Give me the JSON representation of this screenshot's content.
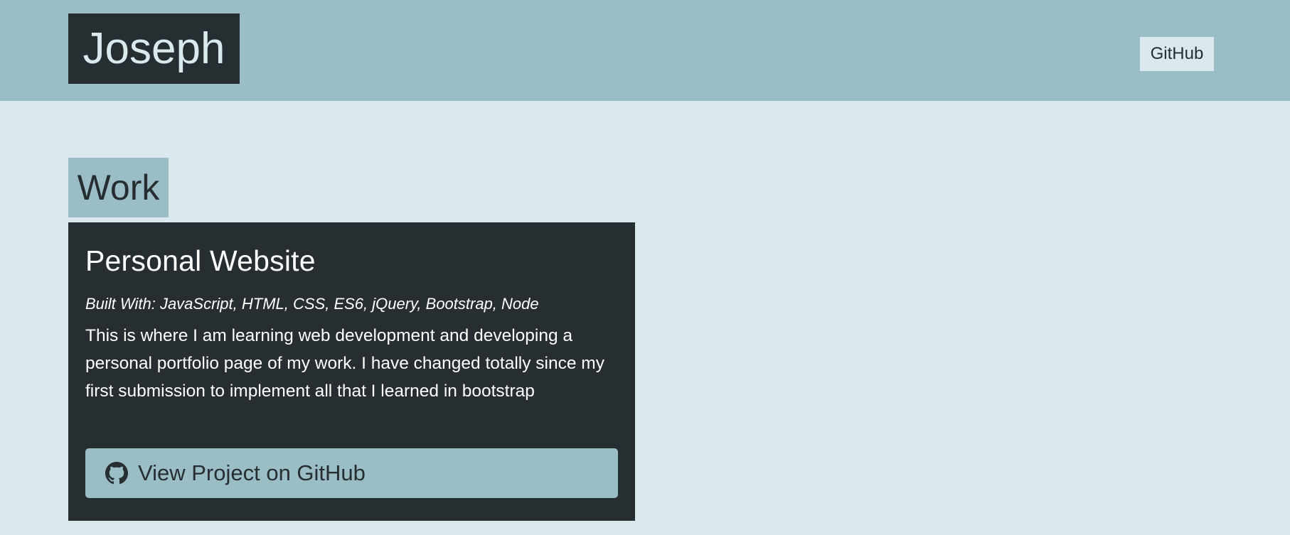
{
  "header": {
    "brand": "Joseph",
    "nav_github": "GitHub"
  },
  "work": {
    "heading": "Work",
    "project": {
      "title": "Personal Website",
      "built_with": "Built With: JavaScript, HTML, CSS, ES6, jQuery, Bootstrap, Node",
      "description": "This is where I am learning web development and developing a personal portfolio page of my work. I have changed totally since my first submission to implement all that I learned in bootstrap",
      "button_label": "View Project on GitHub",
      "button_icon": "github-icon"
    }
  },
  "colors": {
    "navbar_bg": "#9bbdc6",
    "page_bg": "#dae9ee",
    "dark": "#272e32"
  }
}
